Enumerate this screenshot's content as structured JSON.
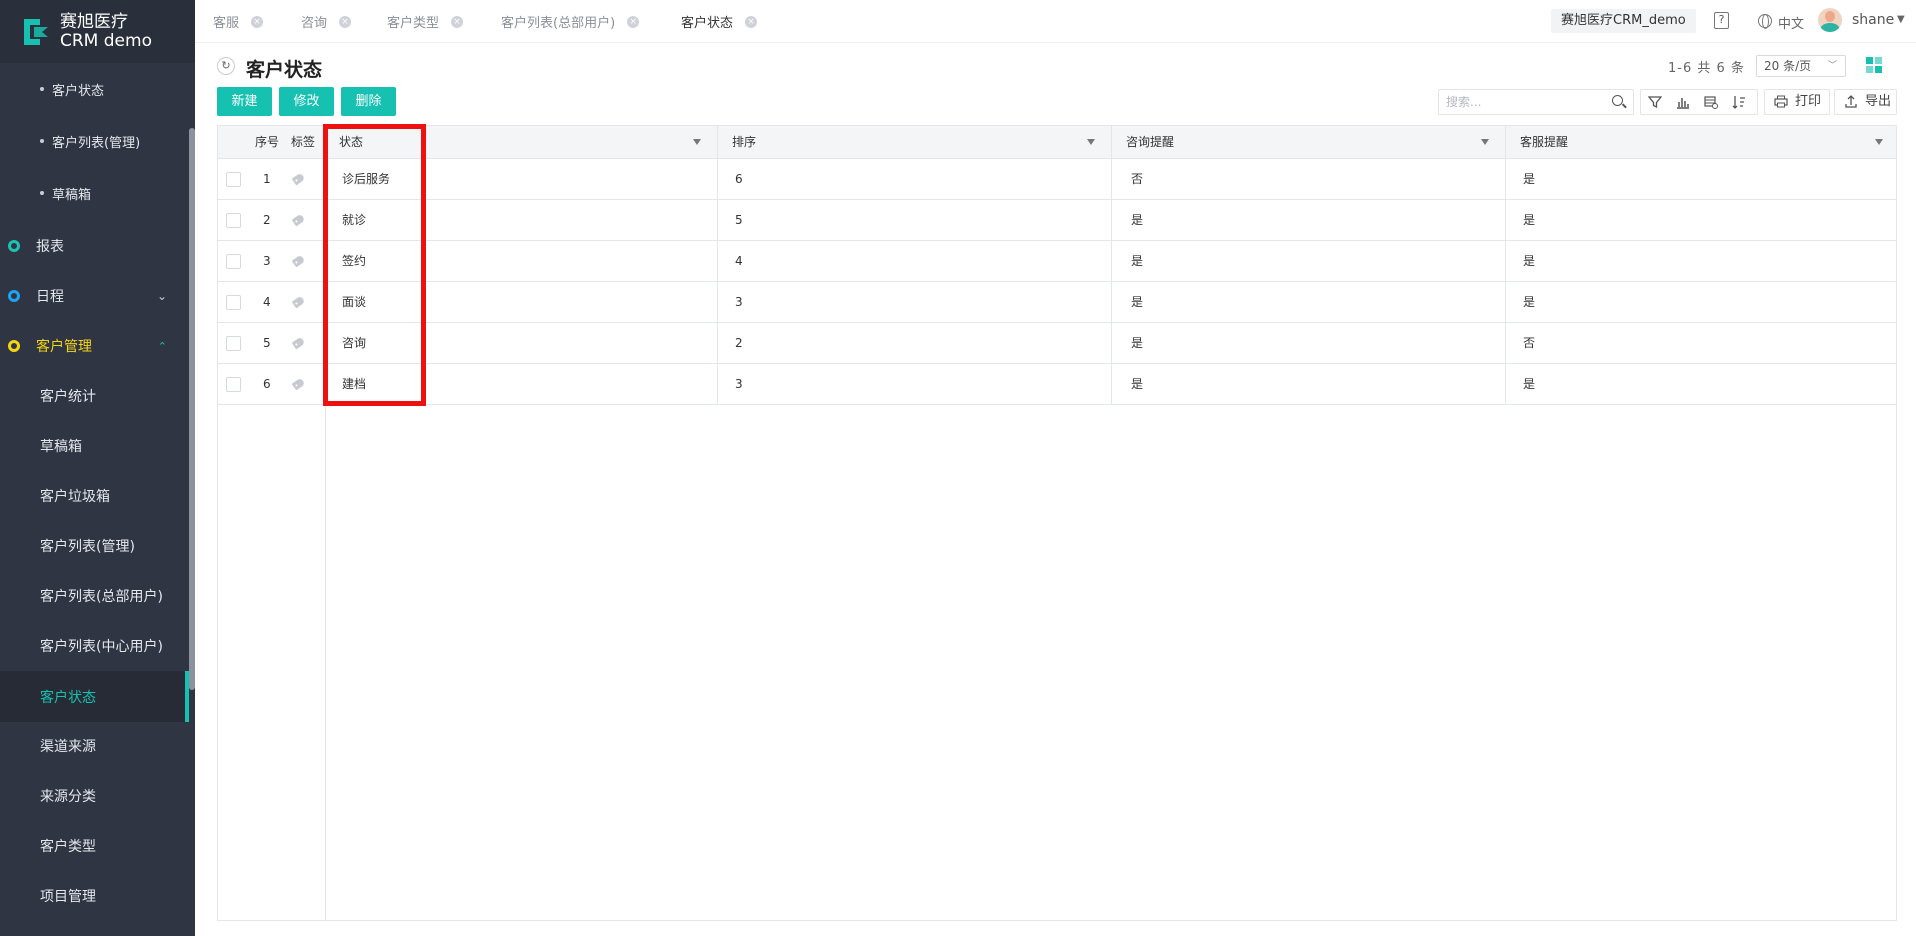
{
  "app": {
    "logo_line1": "赛旭医疗",
    "logo_line2": "CRM demo",
    "accent": "#17c1b2",
    "sidebar_bg": "#2f3542",
    "highlight": "#ee1111"
  },
  "sidebar": {
    "sub_items": [
      "客户状态",
      "客户列表(管理)",
      "草稿箱"
    ],
    "groups": [
      {
        "label": "报表",
        "ring_color": "#1cc3b3",
        "chevron": ""
      },
      {
        "label": "日程",
        "ring_color": "#1ea2f3",
        "chevron": "chevron-down"
      },
      {
        "label": "客户管理",
        "ring_color": "#f4d516",
        "chevron": "chevron-up"
      }
    ],
    "leaf_items": [
      "客户统计",
      "草稿箱",
      "客户垃圾箱",
      "客户列表(管理)",
      "客户列表(总部用户)",
      "客户列表(中心用户)",
      "客户状态",
      "渠道来源",
      "来源分类",
      "客户类型",
      "项目管理"
    ],
    "active_item": "客户状态"
  },
  "tabs": [
    {
      "label": "客服",
      "active": false
    },
    {
      "label": "咨询",
      "active": false
    },
    {
      "label": "客户类型",
      "active": false
    },
    {
      "label": "客户列表(总部用户)",
      "active": false
    },
    {
      "label": "客户状态",
      "active": true
    }
  ],
  "header": {
    "company": "赛旭医疗CRM_demo",
    "help": "?",
    "language": "中文",
    "user": "shane"
  },
  "page": {
    "title": "客户状态",
    "count_text": "1-6 共 6 条",
    "page_size": "20 条/页"
  },
  "toolbar": {
    "new_label": "新建",
    "edit_label": "修改",
    "delete_label": "删除",
    "search_placeholder": "搜索...",
    "print_label": "打印",
    "export_label": "导出"
  },
  "table": {
    "columns": [
      "序号",
      "标签",
      "状态",
      "排序",
      "咨询提醒",
      "客服提醒"
    ],
    "rows": [
      [
        "1",
        "诊后服务",
        "6",
        "否",
        "是"
      ],
      [
        "2",
        "就诊",
        "5",
        "是",
        "是"
      ],
      [
        "3",
        "签约",
        "4",
        "是",
        "是"
      ],
      [
        "4",
        "面谈",
        "3",
        "是",
        "是"
      ],
      [
        "5",
        "咨询",
        "2",
        "是",
        "否"
      ],
      [
        "6",
        "建档",
        "3",
        "是",
        "是"
      ]
    ]
  }
}
